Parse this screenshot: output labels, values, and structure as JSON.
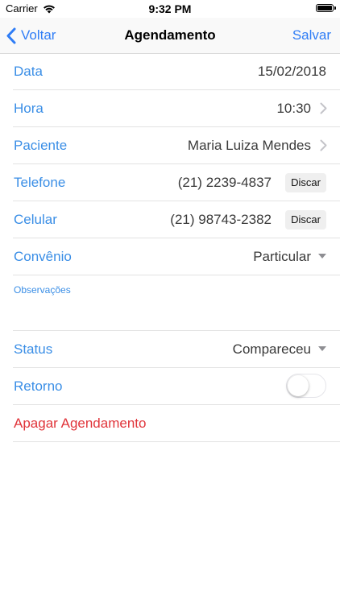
{
  "status_bar": {
    "carrier": "Carrier",
    "time": "9:32 PM"
  },
  "nav": {
    "back_label": "Voltar",
    "title": "Agendamento",
    "save_label": "Salvar"
  },
  "form": {
    "data": {
      "label": "Data",
      "value": "15/02/2018"
    },
    "hora": {
      "label": "Hora",
      "value": "10:30"
    },
    "paciente": {
      "label": "Paciente",
      "value": "Maria Luiza Mendes"
    },
    "telefone": {
      "label": "Telefone",
      "value": "(21) 2239-4837",
      "button": "Discar"
    },
    "celular": {
      "label": "Celular",
      "value": "(21) 98743-2382",
      "button": "Discar"
    },
    "convenio": {
      "label": "Convênio",
      "value": "Particular"
    },
    "observacoes": {
      "label": "Observações"
    },
    "status": {
      "label": "Status",
      "value": "Compareceu"
    },
    "retorno": {
      "label": "Retorno",
      "toggle_on": false
    },
    "apagar": {
      "label": "Apagar Agendamento"
    }
  },
  "colors": {
    "accent": "#3a8ee6",
    "destructive": "#e0343a"
  }
}
